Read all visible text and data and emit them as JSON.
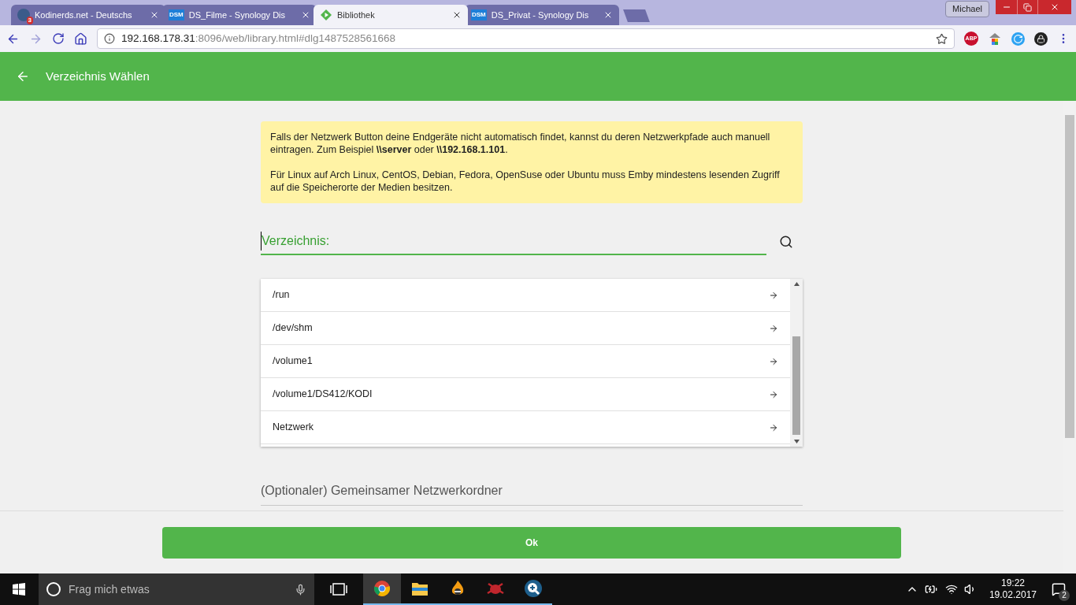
{
  "browser": {
    "tabs": [
      {
        "title": "Kodinerds.net - Deutschs",
        "kind": "kodi",
        "badge": "3",
        "selected": false
      },
      {
        "title": "DS_Filme - Synology Dis",
        "kind": "dsm",
        "badge": "DSM",
        "selected": false
      },
      {
        "title": "Bibliothek",
        "kind": "emby",
        "selected": true
      },
      {
        "title": "DS_Privat - Synology Dis",
        "kind": "dsm",
        "badge": "DSM",
        "selected": false
      }
    ],
    "profile": "Michael",
    "address": {
      "host": "192.168.178.31",
      "path": ":8096/web/library.html#dlg1487528561668"
    },
    "adblock": "ABP"
  },
  "header": {
    "title": "Verzeichnis Wählen"
  },
  "notice": [
    "Falls der Netzwerk Button deine Endgeräte nicht automatisch findet, kannst du deren Netzwerkpfade auch manuell eintragen. Zum Beispiel **\\\\server** oder **\\\\192.168.1.101**.",
    "Für Linux auf Arch Linux, CentOS, Debian, Fedora, OpenSuse oder Ubuntu muss Emby mindestens lesenden Zugriff auf die Speicherorte der Medien besitzen."
  ],
  "directory_field": {
    "label": "Verzeichnis:",
    "focused": true
  },
  "folders": [
    {
      "path": "/run"
    },
    {
      "path": "/dev/shm"
    },
    {
      "path": "/volume1"
    },
    {
      "path": "/volume1/DS412/KODI"
    },
    {
      "path": "Netzwerk"
    }
  ],
  "shared_folder": {
    "heading": "(Optionaler) Gemeinsamer Netzwerkordner"
  },
  "ok_button": "Ok",
  "taskbar": {
    "search_placeholder": "Frag mich etwas",
    "apps": [
      {
        "kind": "chrome",
        "selected": true
      },
      {
        "kind": "explorer",
        "selected": false
      },
      {
        "kind": "flame",
        "selected": false
      },
      {
        "kind": "bug",
        "selected": false
      },
      {
        "kind": "magnifier",
        "selected": false
      }
    ],
    "time": "19:22",
    "date": "19.02.2017",
    "notifications": "2"
  }
}
